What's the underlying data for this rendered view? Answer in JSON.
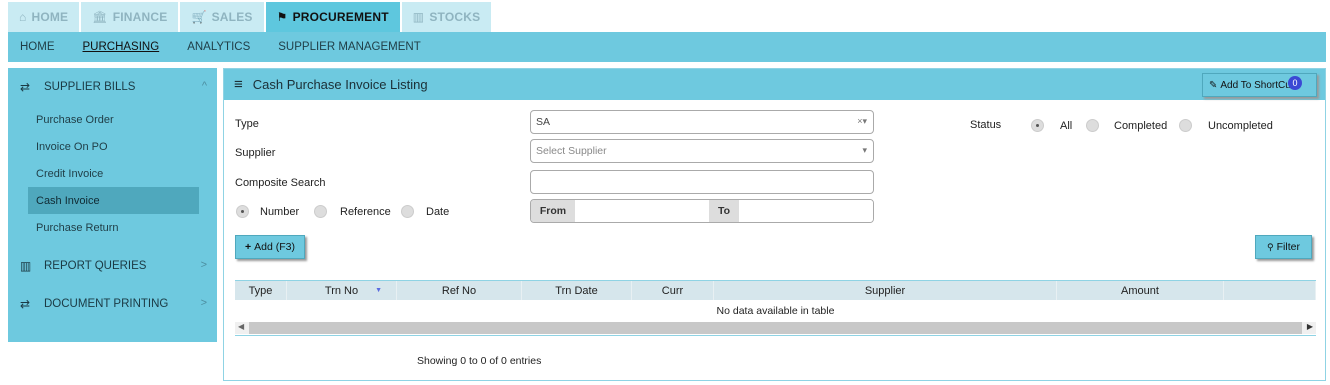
{
  "top_tabs": [
    {
      "label": "HOME",
      "icon": "⌂"
    },
    {
      "label": "FINANCE",
      "icon": "🏛"
    },
    {
      "label": "SALES",
      "icon": "🛒"
    },
    {
      "label": "PROCUREMENT",
      "icon": "⚑"
    },
    {
      "label": "STOCKS",
      "icon": "▥"
    }
  ],
  "sub_nav": [
    "HOME",
    "PURCHASING",
    "ANALYTICS",
    "SUPPLIER MANAGEMENT"
  ],
  "sidebar": {
    "section1": {
      "label": "SUPPLIER BILLS",
      "icon": "⇄",
      "chevron": "^"
    },
    "items": [
      "Purchase Order",
      "Invoice On PO",
      "Credit Invoice",
      "Cash Invoice",
      "Purchase Return"
    ],
    "section2": {
      "label": "REPORT QUERIES",
      "icon": "▥",
      "chevron": ">"
    },
    "section3": {
      "label": "DOCUMENT PRINTING",
      "icon": "⇄",
      "chevron": ">"
    }
  },
  "panel": {
    "title": "Cash Purchase Invoice Listing",
    "menu_icon": "≡",
    "shortcut_label": "Add To ShortCut",
    "shortcut_badge": "0"
  },
  "form": {
    "type_label": "Type",
    "type_value": "SA",
    "type_clear": "×▾",
    "supplier_label": "Supplier",
    "supplier_placeholder": "Select Supplier",
    "supplier_caret": "▾",
    "composite_label": "Composite Search",
    "composite_value": "",
    "search_by": [
      "Number",
      "Reference",
      "Date"
    ],
    "from_label": "From",
    "to_label": "To",
    "status_label": "Status",
    "status_options": [
      "All",
      "Completed",
      "Uncompleted"
    ],
    "add_label": "Add (F3)",
    "add_icon": "+",
    "filter_label": "Filter",
    "filter_icon": "🔍"
  },
  "table": {
    "columns": [
      "Type",
      "Trn No",
      "Ref No",
      "Trn Date",
      "Curr",
      "Supplier",
      "Amount"
    ],
    "empty_text": "No data available in table",
    "info_text": "Showing 0 to 0 of 0 entries",
    "sort_indicator": "▼"
  }
}
